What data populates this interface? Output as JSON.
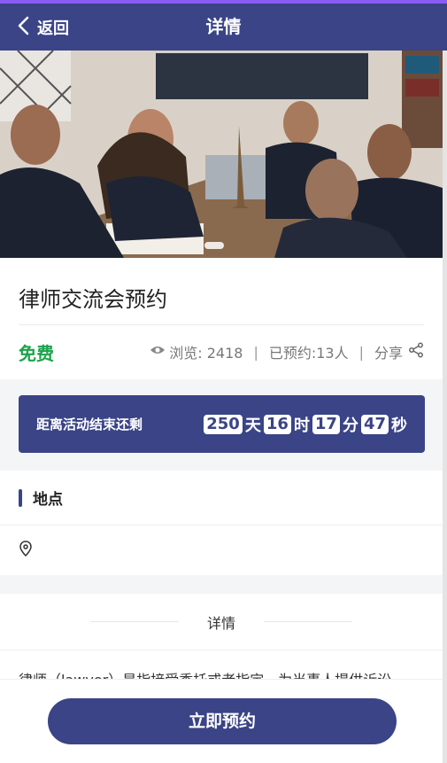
{
  "nav": {
    "back_label": "返回",
    "title": "详情"
  },
  "event": {
    "title": "律师交流会预约",
    "price": "免费",
    "views": "浏览: 2418",
    "booked": "已预约:13人",
    "share_label": "分享"
  },
  "countdown": {
    "label": "距离活动结束还剩",
    "days": "250",
    "days_unit": "天",
    "hours": "16",
    "hours_unit": "时",
    "minutes": "17",
    "minutes_unit": "分",
    "seconds": "47",
    "seconds_unit": "秒"
  },
  "location": {
    "title": "地点",
    "address": ""
  },
  "detail": {
    "title": "详情",
    "text": "律师（lawyer）是指接受委托或者指定，为当事人提供诉讼"
  },
  "actions": {
    "book_label": "立即预约"
  },
  "colors": {
    "primary": "#3a4486",
    "price_green": "#1aa34a"
  },
  "icons": {
    "back": "chevron-left-icon",
    "views": "eye-icon",
    "share": "share-icon",
    "location": "location-pin-icon"
  }
}
